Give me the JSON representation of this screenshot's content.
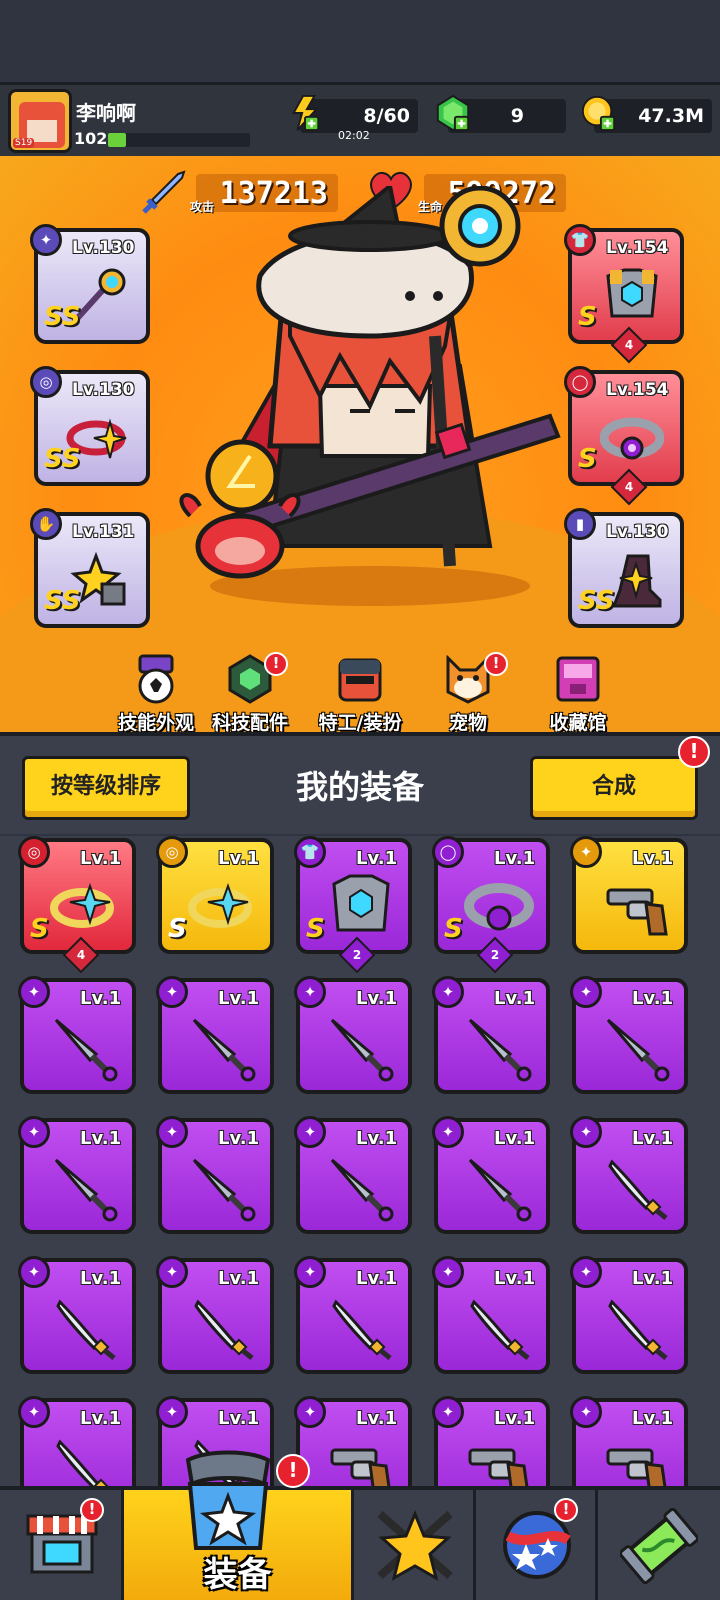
{
  "player": {
    "name": "李响啊",
    "level": "102",
    "avatar_tag": "S19",
    "xp_progress": 0.13
  },
  "resources": {
    "energy": {
      "value": "8/60",
      "timer": "02:02"
    },
    "gems": {
      "value": "9"
    },
    "coins": {
      "value": "47.3M"
    }
  },
  "stats": {
    "attack": {
      "label": "攻击",
      "value": "137213"
    },
    "hp": {
      "label": "生命",
      "value": "599272"
    }
  },
  "equipped": {
    "left": [
      {
        "level": "Lv.130",
        "rarity": "SS",
        "icon": "staff-icon"
      },
      {
        "level": "Lv.130",
        "rarity": "SS",
        "icon": "ring-icon"
      },
      {
        "level": "Lv.131",
        "rarity": "SS",
        "icon": "glove-icon"
      }
    ],
    "right": [
      {
        "level": "Lv.154",
        "rarity": "S",
        "stars": "4",
        "icon": "armor-icon"
      },
      {
        "level": "Lv.154",
        "rarity": "S",
        "stars": "4",
        "icon": "belt-icon"
      },
      {
        "level": "Lv.130",
        "rarity": "SS",
        "icon": "boot-icon"
      }
    ]
  },
  "nav": [
    {
      "label": "技能外观",
      "icon": "skill-skin-icon",
      "alert": false
    },
    {
      "label": "科技配件",
      "icon": "tech-part-icon",
      "alert": true
    },
    {
      "label": "特工/装扮",
      "icon": "agent-costume-icon",
      "alert": false
    },
    {
      "label": "宠物",
      "icon": "pet-icon",
      "alert": true
    },
    {
      "label": "收藏馆",
      "icon": "collection-icon",
      "alert": false
    }
  ],
  "inventory_header": {
    "sort_button": "按等级排序",
    "title": "我的装备",
    "merge_button": "合成",
    "alert_glyph": "!"
  },
  "inventory": [
    {
      "level": "Lv.1",
      "rarity": "S",
      "stars": "4",
      "color": "red",
      "icon": "ring-icon"
    },
    {
      "level": "Lv.1",
      "rarity": "S",
      "color": "yellow",
      "icon": "ring-icon"
    },
    {
      "level": "Lv.1",
      "rarity": "S",
      "stars": "2",
      "color": "purple",
      "icon": "armor-icon"
    },
    {
      "level": "Lv.1",
      "rarity": "S",
      "stars": "2",
      "color": "purple",
      "icon": "belt-icon"
    },
    {
      "level": "Lv.1",
      "color": "yellow",
      "icon": "revolver-icon"
    },
    {
      "level": "Lv.1",
      "color": "purple",
      "icon": "kunai-icon"
    },
    {
      "level": "Lv.1",
      "color": "purple",
      "icon": "kunai-icon"
    },
    {
      "level": "Lv.1",
      "color": "purple",
      "icon": "kunai-icon"
    },
    {
      "level": "Lv.1",
      "color": "purple",
      "icon": "kunai-icon"
    },
    {
      "level": "Lv.1",
      "color": "purple",
      "icon": "kunai-icon"
    },
    {
      "level": "Lv.1",
      "color": "purple",
      "icon": "kunai-icon"
    },
    {
      "level": "Lv.1",
      "color": "purple",
      "icon": "kunai-icon"
    },
    {
      "level": "Lv.1",
      "color": "purple",
      "icon": "kunai-icon"
    },
    {
      "level": "Lv.1",
      "color": "purple",
      "icon": "kunai-icon"
    },
    {
      "level": "Lv.1",
      "color": "purple",
      "icon": "katana-icon"
    },
    {
      "level": "Lv.1",
      "color": "purple",
      "icon": "katana-icon"
    },
    {
      "level": "Lv.1",
      "color": "purple",
      "icon": "katana-icon"
    },
    {
      "level": "Lv.1",
      "color": "purple",
      "icon": "katana-icon"
    },
    {
      "level": "Lv.1",
      "color": "purple",
      "icon": "katana-icon"
    },
    {
      "level": "Lv.1",
      "color": "purple",
      "icon": "katana-icon"
    },
    {
      "level": "Lv.1",
      "color": "purple",
      "icon": "katana-icon"
    },
    {
      "level": "Lv.1",
      "color": "purple",
      "icon": "katana-icon"
    },
    {
      "level": "Lv.1",
      "color": "purple",
      "icon": "revolver-icon"
    },
    {
      "level": "Lv.1",
      "color": "purple",
      "icon": "revolver-icon"
    },
    {
      "level": "Lv.1",
      "color": "purple",
      "icon": "revolver-icon"
    }
  ],
  "bottom_nav": [
    {
      "icon": "shop-icon",
      "alert": true
    },
    {
      "label": "装备",
      "icon": "equipment-icon",
      "alert": true,
      "active": true
    },
    {
      "icon": "battle-star-icon",
      "alert": false
    },
    {
      "icon": "talent-orb-icon",
      "alert": true
    },
    {
      "icon": "evolution-capsule-icon",
      "alert": false
    }
  ],
  "colors": {
    "hero_bg": "#ff8c12",
    "button_yellow": "#ffd21c",
    "item_purple": "#9a28d8",
    "item_red": "#e2283c",
    "item_yellow": "#f5b80c",
    "alert_red": "#e8212e"
  }
}
